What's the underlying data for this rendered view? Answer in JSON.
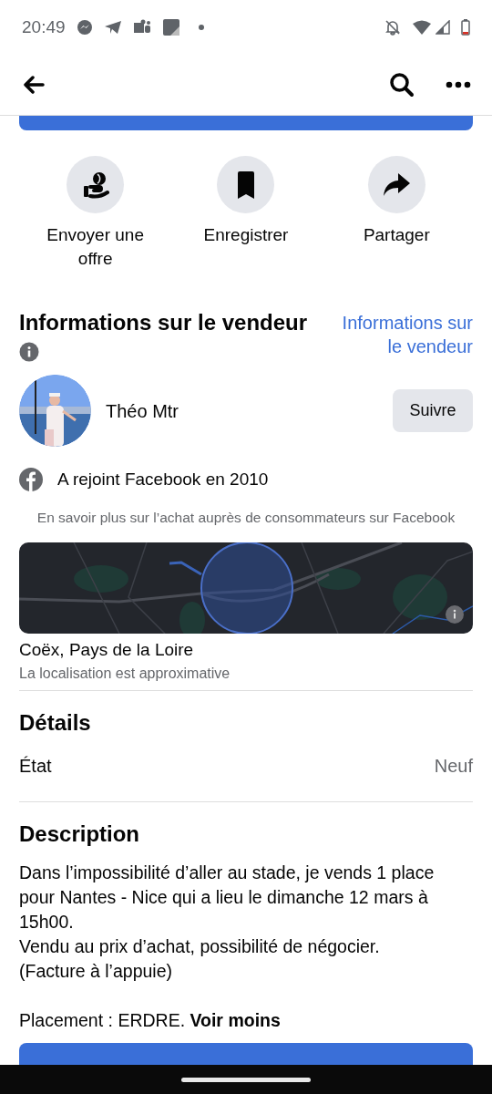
{
  "status_bar": {
    "time": "20:49"
  },
  "action_buttons": [
    {
      "label": "Envoyer une offre",
      "kind": "offer"
    },
    {
      "label": "Enregistrer",
      "kind": "save"
    },
    {
      "label": "Partager",
      "kind": "share"
    }
  ],
  "seller_section": {
    "title": "Informations sur le vendeur",
    "link": "Informations sur le vendeur"
  },
  "seller": {
    "name": "Théo Mtr",
    "follow_button": "Suivre",
    "joined": "A rejoint Facebook en 2010"
  },
  "learn_more": "En savoir plus sur l’achat auprès de consommateurs sur Facebook",
  "location": {
    "name": "Coëx, Pays de la Loire",
    "note": "La localisation est approximative"
  },
  "details": {
    "title": "Détails",
    "rows": [
      {
        "label": "État",
        "value": "Neuf"
      }
    ]
  },
  "description": {
    "title": "Description",
    "text": "Dans l’impossibilité d’aller au stade, je vends 1 place pour Nantes - Nice qui a lieu le dimanche 12 mars à 15h00.\nVendu au prix d’achat, possibilité de négocier.\n(Facture à l’appuie)",
    "placement": "Placement : ERDRE.",
    "toggle": "Voir moins"
  }
}
